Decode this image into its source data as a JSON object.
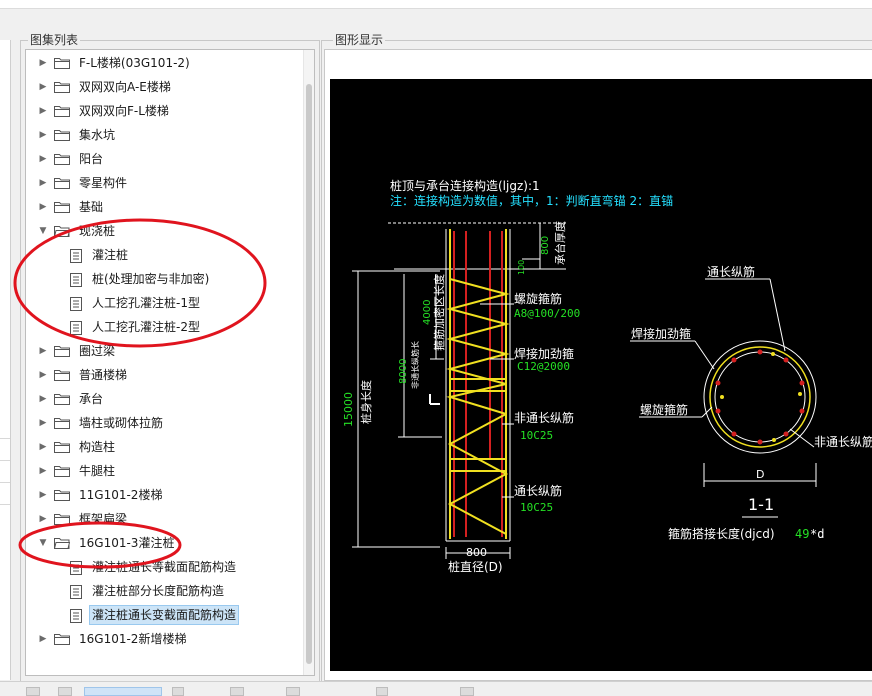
{
  "panels": {
    "tree_title": "图集列表",
    "drawing_title": "图形显示"
  },
  "tree": {
    "items": [
      {
        "label": "F-L楼梯(03G101-2)",
        "type": "folder",
        "expanded": false
      },
      {
        "label": "双网双向A-E楼梯",
        "type": "folder",
        "expanded": false
      },
      {
        "label": "双网双向F-L楼梯",
        "type": "folder",
        "expanded": false
      },
      {
        "label": "集水坑",
        "type": "folder",
        "expanded": false
      },
      {
        "label": "阳台",
        "type": "folder",
        "expanded": false
      },
      {
        "label": "零星构件",
        "type": "folder",
        "expanded": false
      },
      {
        "label": "基础",
        "type": "folder",
        "expanded": false
      },
      {
        "label": "现浇桩",
        "type": "folder",
        "expanded": true
      },
      {
        "label": "灌注桩",
        "type": "doc"
      },
      {
        "label": "桩(处理加密与非加密)",
        "type": "doc"
      },
      {
        "label": "人工挖孔灌注桩-1型",
        "type": "doc"
      },
      {
        "label": "人工挖孔灌注桩-2型",
        "type": "doc"
      },
      {
        "label": "圈过梁",
        "type": "folder",
        "expanded": false
      },
      {
        "label": "普通楼梯",
        "type": "folder",
        "expanded": false
      },
      {
        "label": "承台",
        "type": "folder",
        "expanded": false
      },
      {
        "label": "墙柱或砌体拉筋",
        "type": "folder",
        "expanded": false
      },
      {
        "label": "构造柱",
        "type": "folder",
        "expanded": false
      },
      {
        "label": "牛腿柱",
        "type": "folder",
        "expanded": false
      },
      {
        "label": "11G101-2楼梯",
        "type": "folder",
        "expanded": false
      },
      {
        "label": "框架扁梁",
        "type": "folder",
        "expanded": false
      },
      {
        "label": "16G101-3灌注桩",
        "type": "folder",
        "expanded": true
      },
      {
        "label": "灌注桩通长等截面配筋构造",
        "type": "doc"
      },
      {
        "label": "灌注桩部分长度配筋构造",
        "type": "doc"
      },
      {
        "label": "灌注桩通长变截面配筋构造",
        "type": "doc",
        "selected": true
      },
      {
        "label": "16G101-2新增楼梯",
        "type": "folder",
        "expanded": false
      }
    ]
  },
  "drawing": {
    "title_line": "桩顶与承台连接构造(ljgz):1",
    "note_line": "注：连接构造为数值，其中，1：判断直弯锚      2：直锚",
    "cap_thickness_label": "承台厚度",
    "cap_thickness_value": "800",
    "top_offset_value": "100",
    "dense_zone_label": "箍筋加密区长度",
    "dense_zone_value": "4000",
    "non_through_label": "非通长纵筋长",
    "non_through_value": "8000",
    "pile_length_label": "桩身长度",
    "pile_length_value": "15000",
    "spiral_stirrup_label": "螺旋箍筋",
    "spiral_stirrup_value": "A8@100/200",
    "weld_stirrup_label": "焊接加劲箍",
    "weld_stirrup_value": "C12@2000",
    "non_through_bar_label": "非通长纵筋",
    "non_through_bar_value": "10C25",
    "through_bar_label": "通长纵筋",
    "through_bar_value": "10C25",
    "diameter_value": "800",
    "diameter_label": "桩直径(D)",
    "section_through_label": "通长纵筋",
    "section_weld_label": "焊接加劲箍",
    "section_spiral_label": "螺旋箍筋",
    "section_nonthrough_label": "非通长纵筋",
    "section_d_label": "D",
    "section_name": "1-1",
    "lap_label": "箍筋搭接长度(djcd)",
    "lap_value": "49",
    "lap_suffix": "*d",
    "section_mark": "1"
  },
  "colors": {
    "bar_red": "#d42020",
    "stirrup_yellow": "#f0e020",
    "text_white": "#ffffff",
    "text_cyan": "#25e0ff",
    "text_green": "#25e025",
    "dim_white": "#ffffff",
    "annotation_red": "#e0141e",
    "selection_blue": "#cce4f7"
  }
}
